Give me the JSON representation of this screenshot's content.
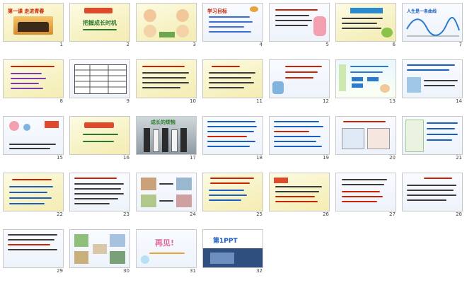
{
  "slides": [
    {
      "number": "1",
      "title": "第一课 走进青春",
      "theme": "cream"
    },
    {
      "number": "2",
      "title": "把握成长时机",
      "theme": "cream"
    },
    {
      "number": "3",
      "title": "",
      "theme": "cream"
    },
    {
      "number": "4",
      "title": "学习目标",
      "theme": "pale"
    },
    {
      "number": "5",
      "title": "",
      "theme": "pale"
    },
    {
      "number": "6",
      "title": "",
      "theme": "cream"
    },
    {
      "number": "7",
      "title": "人生是一条曲线",
      "theme": "pale"
    },
    {
      "number": "8",
      "title": "",
      "theme": "cream"
    },
    {
      "number": "9",
      "title": "",
      "theme": "pale"
    },
    {
      "number": "10",
      "title": "",
      "theme": "cream"
    },
    {
      "number": "11",
      "title": "",
      "theme": "cream"
    },
    {
      "number": "12",
      "title": "",
      "theme": "pale"
    },
    {
      "number": "13",
      "title": "",
      "theme": "spring"
    },
    {
      "number": "14",
      "title": "",
      "theme": "pale"
    },
    {
      "number": "15",
      "title": "",
      "theme": "pale"
    },
    {
      "number": "16",
      "title": "",
      "theme": "cream"
    },
    {
      "number": "17",
      "title": "成长的烦恼",
      "theme": "photo"
    },
    {
      "number": "18",
      "title": "",
      "theme": "pale"
    },
    {
      "number": "19",
      "title": "",
      "theme": "pale"
    },
    {
      "number": "20",
      "title": "",
      "theme": "pale"
    },
    {
      "number": "21",
      "title": "",
      "theme": "pale"
    },
    {
      "number": "22",
      "title": "",
      "theme": "cream"
    },
    {
      "number": "23",
      "title": "",
      "theme": "pale"
    },
    {
      "number": "24",
      "title": "",
      "theme": "pale"
    },
    {
      "number": "25",
      "title": "",
      "theme": "cream"
    },
    {
      "number": "26",
      "title": "",
      "theme": "cream"
    },
    {
      "number": "27",
      "title": "",
      "theme": "pale"
    },
    {
      "number": "28",
      "title": "",
      "theme": "pale"
    },
    {
      "number": "29",
      "title": "",
      "theme": "pale"
    },
    {
      "number": "30",
      "title": "",
      "theme": "pale"
    },
    {
      "number": "31",
      "title": "再见!",
      "theme": "pale"
    },
    {
      "number": "32",
      "title": "第1PPT",
      "theme": "ppt"
    }
  ]
}
